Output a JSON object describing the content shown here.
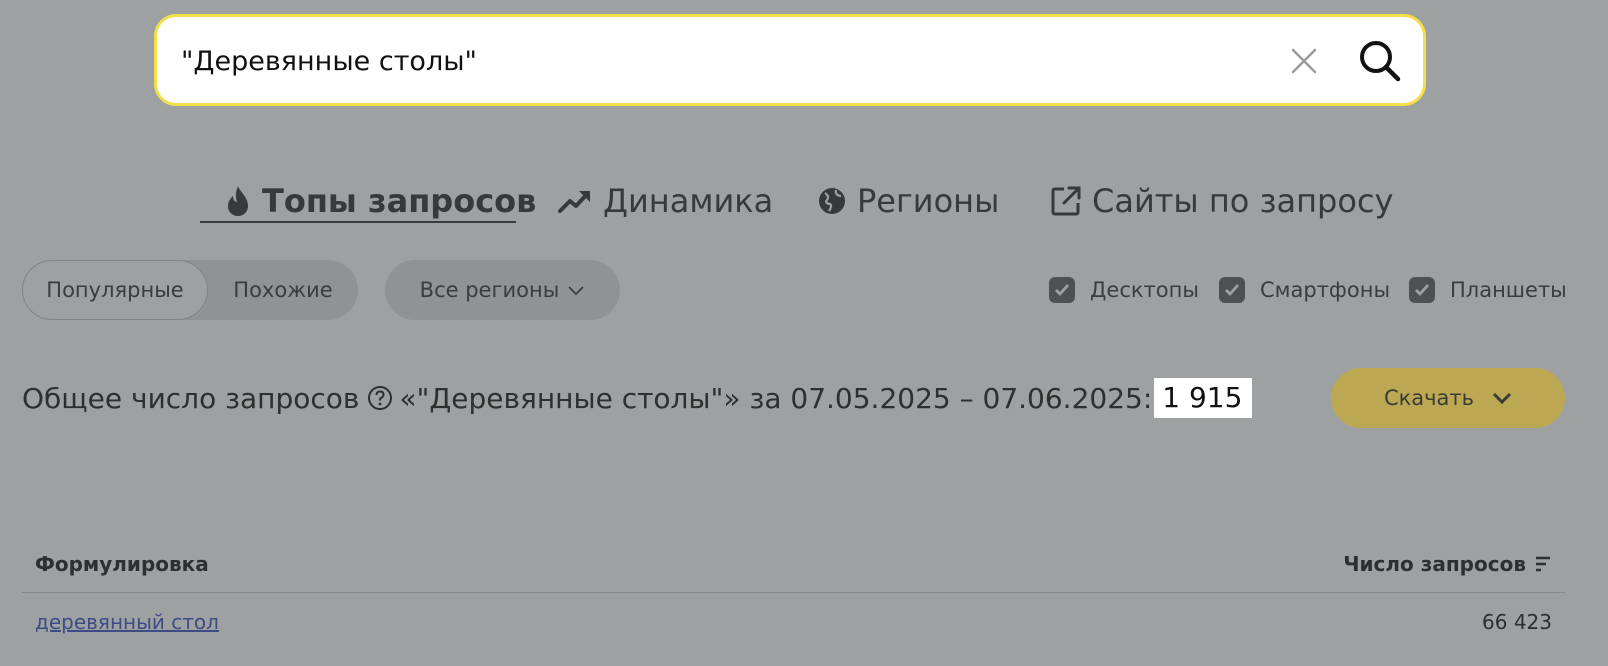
{
  "search": {
    "value": "\"Деревянные столы\"",
    "clear_icon": "close-icon",
    "search_icon": "search-icon",
    "border_color": "#f4df48"
  },
  "tabs": [
    {
      "label": "Топы запросов",
      "icon": "fire-icon",
      "active": true
    },
    {
      "label": "Динамика",
      "icon": "trend-up-icon",
      "active": false
    },
    {
      "label": "Регионы",
      "icon": "globe-icon",
      "active": false
    },
    {
      "label": "Сайты по запросу",
      "icon": "external-link-icon",
      "active": false
    }
  ],
  "filters": {
    "segments": [
      {
        "label": "Популярные",
        "selected": true
      },
      {
        "label": "Похожие",
        "selected": false
      }
    ],
    "region": {
      "label": "Все регионы",
      "icon": "chevron-down-icon"
    },
    "devices": [
      {
        "label": "Десктопы",
        "checked": true
      },
      {
        "label": "Смартфоны",
        "checked": true
      },
      {
        "label": "Планшеты",
        "checked": true
      }
    ]
  },
  "summary": {
    "prefix": "Общее число запросов",
    "help_icon": "question-circle-icon",
    "suffix": "«\"Деревянные столы\"» за 07.05.2025 – 07.06.2025:",
    "count": "1 915"
  },
  "download": {
    "label": "Скачать",
    "icon": "chevron-down-icon",
    "color": "#bca852"
  },
  "table": {
    "columns": [
      "Формулировка",
      "Число запросов"
    ],
    "sort_icon": "sort-icon",
    "rows": [
      {
        "phrase": "деревянный стол",
        "count": "66 423"
      }
    ]
  },
  "colors": {
    "overlay_background": "#9da1a1",
    "link": "#3e4c86"
  }
}
